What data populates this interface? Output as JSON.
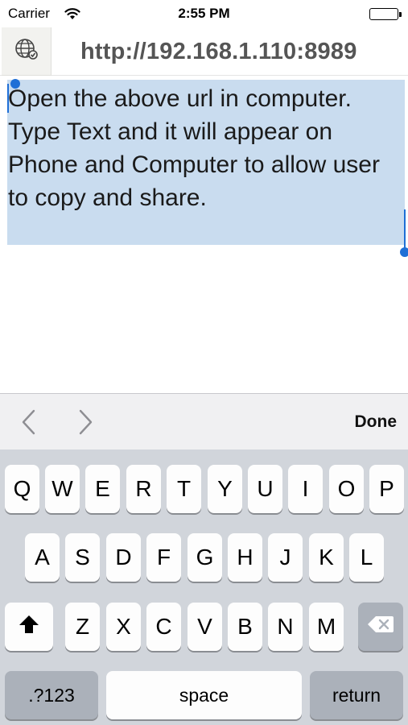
{
  "status_bar": {
    "carrier": "Carrier",
    "time": "2:55 PM",
    "wifi_icon": "wifi-icon",
    "battery_icon": "battery-icon",
    "battery_level": 1.0
  },
  "header": {
    "globe_icon": "globe-icon",
    "url": "http://192.168.1.110:8989"
  },
  "editor": {
    "text": "Open the above url in computer. Type Text and it will appear on Phone and Computer to allow user to copy and share.",
    "selected": true,
    "selection_color": "#c9dcef",
    "handle_color": "#1f6fd6"
  },
  "toolbar": {
    "prev_icon": "chevron-left-icon",
    "next_icon": "chevron-right-icon",
    "done_label": "Done"
  },
  "keyboard": {
    "row1": [
      "Q",
      "W",
      "E",
      "R",
      "T",
      "Y",
      "U",
      "I",
      "O",
      "P"
    ],
    "row2": [
      "A",
      "S",
      "D",
      "F",
      "G",
      "H",
      "J",
      "K",
      "L"
    ],
    "row3": [
      "Z",
      "X",
      "C",
      "V",
      "B",
      "N",
      "M"
    ],
    "shift_icon": "shift-icon",
    "delete_icon": "delete-icon",
    "numbers_label": ".?123",
    "space_label": "space",
    "return_label": "return"
  }
}
